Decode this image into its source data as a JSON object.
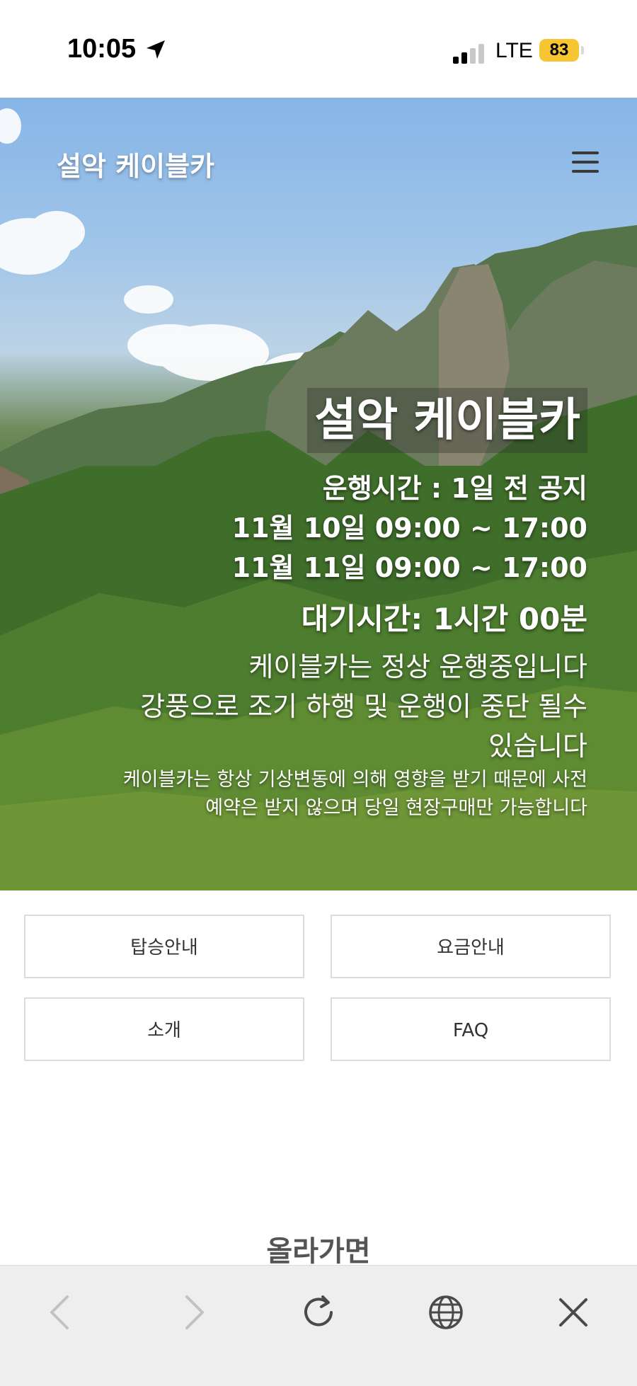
{
  "status_bar": {
    "time": "10:05",
    "network": "LTE",
    "battery": "83",
    "icons": [
      "location-arrow-icon",
      "cellular-signal-icon",
      "battery-icon"
    ],
    "battery_color": "#f7c531"
  },
  "header": {
    "site_title": "설악 케이블카",
    "menu_icon": "hamburger-menu-icon"
  },
  "hero": {
    "title": "설악 케이블카",
    "hours_heading": "운행시간 : 1일 전 공지",
    "hours": [
      "11월 10일 09:00 ~ 17:00",
      "11월 11일 09:00 ~ 17:00"
    ],
    "wait_time": "대기시간: 1시간 00분",
    "status_lines": [
      "케이블카는 정상 운행중입니다",
      "강풍으로 조기 하행 및 운행이 중단 될수",
      "있습니다"
    ],
    "note_lines": [
      "케이블카는 항상 기상변동에 의해 영향을 받기 때문에 사전",
      "예약은 받지 않으며 당일 현장구매만 가능합니다"
    ]
  },
  "menu": {
    "items": [
      {
        "label": "탑승안내"
      },
      {
        "label": "요금안내"
      },
      {
        "label": "소개"
      },
      {
        "label": "FAQ"
      }
    ]
  },
  "section": {
    "heading": "올라가면"
  },
  "toolbar": {
    "buttons": [
      "back-icon",
      "forward-icon",
      "reload-icon",
      "globe-icon",
      "close-icon"
    ],
    "background": "#eeeeef"
  }
}
